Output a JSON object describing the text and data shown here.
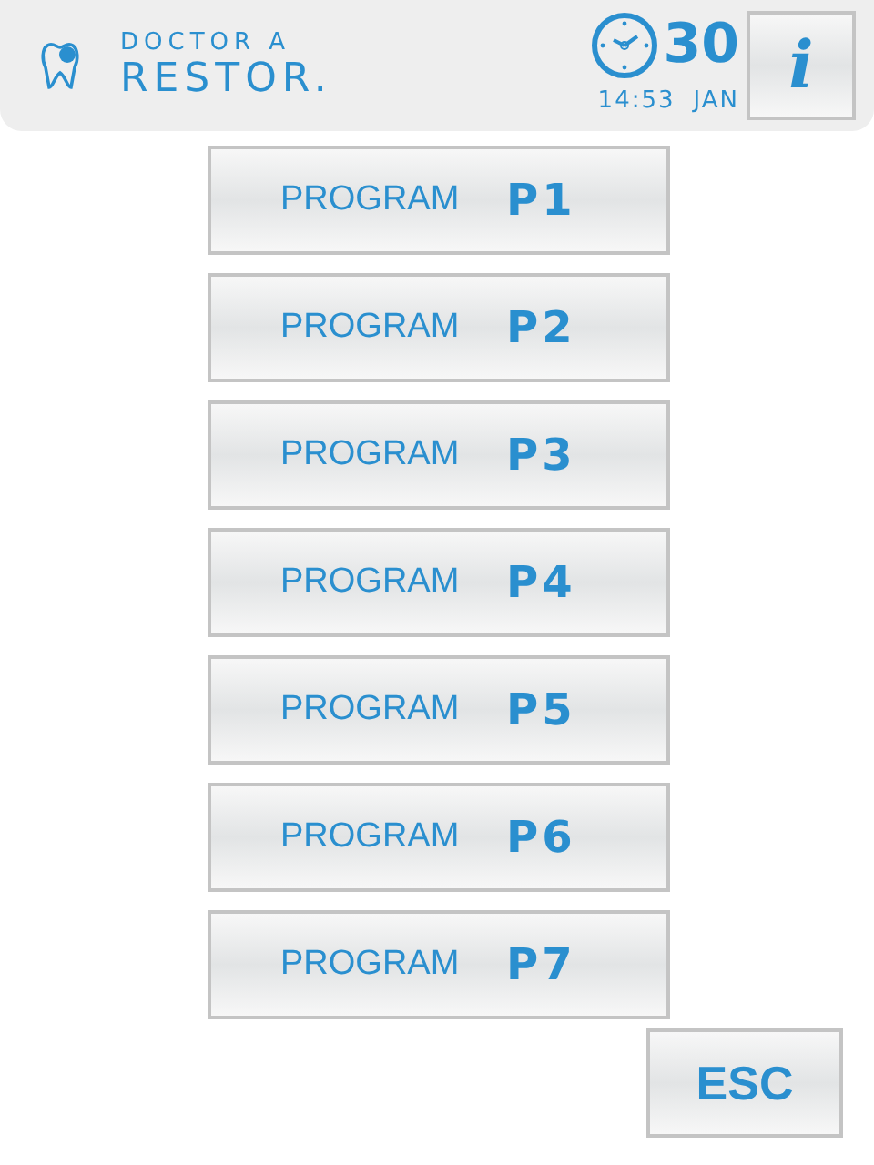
{
  "header": {
    "brand_line_1": "DOCTOR A",
    "brand_line_2": "RESTOR.",
    "day": "30",
    "time": "14:53",
    "month": "JAN",
    "info_button": "i"
  },
  "programs": [
    {
      "label": "PROGRAM",
      "code": "P1"
    },
    {
      "label": "PROGRAM",
      "code": "P2"
    },
    {
      "label": "PROGRAM",
      "code": "P3"
    },
    {
      "label": "PROGRAM",
      "code": "P4"
    },
    {
      "label": "PROGRAM",
      "code": "P5"
    },
    {
      "label": "PROGRAM",
      "code": "P6"
    },
    {
      "label": "PROGRAM",
      "code": "P7"
    }
  ],
  "esc_button": "ESC"
}
